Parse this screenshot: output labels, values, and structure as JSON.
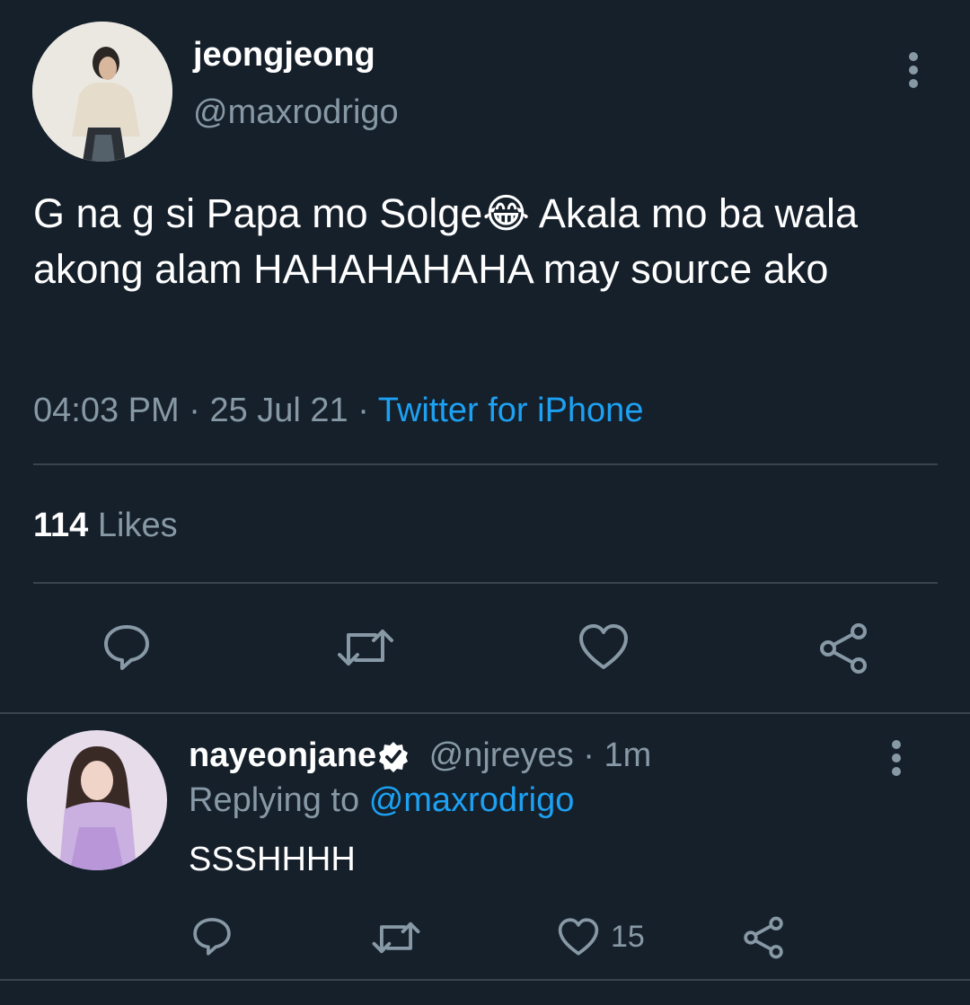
{
  "tweet": {
    "author": {
      "display_name": "jeongjeong",
      "handle": "@maxrodrigo"
    },
    "text": "G na g si Papa mo Solge😂 Akala mo ba wala akong alam HAHAHAHAHA may source ako",
    "time": "04:03 PM",
    "sep1": "·",
    "date": "25 Jul 21",
    "sep2": "·",
    "source": "Twitter for iPhone",
    "likes_count": "114",
    "likes_label": "Likes"
  },
  "reply": {
    "author": {
      "display_name": "nayeonjane",
      "handle": "@njreyes",
      "time": "· 1m"
    },
    "replying_prefix": "Replying to",
    "replying_handle": "@maxrodrigo",
    "text": "SSSHHHH",
    "like_count": "15"
  },
  "colors": {
    "background": "#15202b",
    "muted": "#8899a6",
    "link": "#1da1f2",
    "divider": "#38444d"
  },
  "icons": {
    "reply": "reply-icon",
    "retweet": "retweet-icon",
    "like": "heart-icon",
    "share": "share-icon",
    "more": "more-vertical-icon",
    "verified": "verified-badge-icon"
  }
}
